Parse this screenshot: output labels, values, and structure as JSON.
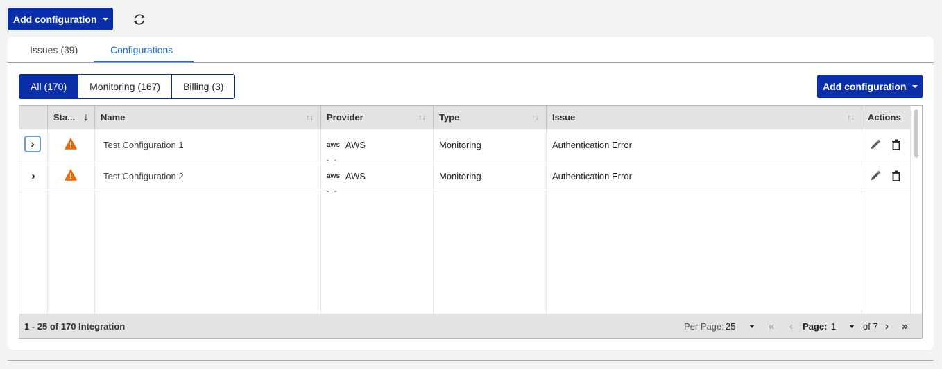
{
  "toolbar": {
    "add_label": "Add configuration"
  },
  "tabs": [
    {
      "label": "Issues (39)"
    },
    {
      "label": "Configurations"
    }
  ],
  "filters": [
    {
      "label": "All (170)"
    },
    {
      "label": "Monitoring (167)"
    },
    {
      "label": "Billing (3)"
    }
  ],
  "add_button_label": "Add configuration",
  "columns": {
    "status": "Sta...",
    "name": "Name",
    "provider": "Provider",
    "type": "Type",
    "issue": "Issue",
    "actions": "Actions"
  },
  "rows": [
    {
      "name": "Test Configuration 1",
      "provider_logo": "aws",
      "provider": "AWS",
      "type": "Monitoring",
      "issue": "Authentication Error"
    },
    {
      "name": "Test Configuration 2",
      "provider_logo": "aws",
      "provider": "AWS",
      "type": "Monitoring",
      "issue": "Authentication Error"
    }
  ],
  "footer": {
    "range": "1 - 25 of 170 Integration",
    "per_page_label": "Per Page:",
    "per_page_value": "25",
    "page_label": "Page:",
    "page_value": "1",
    "page_of": "of 7"
  },
  "colors": {
    "accent": "#0b2fa8",
    "tab_active": "#1d6ad6",
    "warning": "#ee6a00"
  },
  "icons": [
    "refresh-icon",
    "chevron-right-icon",
    "warning-icon",
    "aws-logo",
    "pencil-icon",
    "trash-icon",
    "sort-icon",
    "sort-desc-icon"
  ]
}
